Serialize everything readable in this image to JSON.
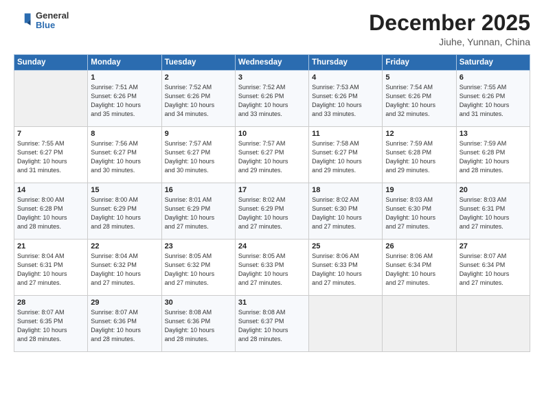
{
  "header": {
    "logo_general": "General",
    "logo_blue": "Blue",
    "month_title": "December 2025",
    "location": "Jiuhe, Yunnan, China"
  },
  "weekdays": [
    "Sunday",
    "Monday",
    "Tuesday",
    "Wednesday",
    "Thursday",
    "Friday",
    "Saturday"
  ],
  "weeks": [
    [
      {
        "day": "",
        "text": ""
      },
      {
        "day": "1",
        "text": "Sunrise: 7:51 AM\nSunset: 6:26 PM\nDaylight: 10 hours\nand 35 minutes."
      },
      {
        "day": "2",
        "text": "Sunrise: 7:52 AM\nSunset: 6:26 PM\nDaylight: 10 hours\nand 34 minutes."
      },
      {
        "day": "3",
        "text": "Sunrise: 7:52 AM\nSunset: 6:26 PM\nDaylight: 10 hours\nand 33 minutes."
      },
      {
        "day": "4",
        "text": "Sunrise: 7:53 AM\nSunset: 6:26 PM\nDaylight: 10 hours\nand 33 minutes."
      },
      {
        "day": "5",
        "text": "Sunrise: 7:54 AM\nSunset: 6:26 PM\nDaylight: 10 hours\nand 32 minutes."
      },
      {
        "day": "6",
        "text": "Sunrise: 7:55 AM\nSunset: 6:26 PM\nDaylight: 10 hours\nand 31 minutes."
      }
    ],
    [
      {
        "day": "7",
        "text": "Sunrise: 7:55 AM\nSunset: 6:27 PM\nDaylight: 10 hours\nand 31 minutes."
      },
      {
        "day": "8",
        "text": "Sunrise: 7:56 AM\nSunset: 6:27 PM\nDaylight: 10 hours\nand 30 minutes."
      },
      {
        "day": "9",
        "text": "Sunrise: 7:57 AM\nSunset: 6:27 PM\nDaylight: 10 hours\nand 30 minutes."
      },
      {
        "day": "10",
        "text": "Sunrise: 7:57 AM\nSunset: 6:27 PM\nDaylight: 10 hours\nand 29 minutes."
      },
      {
        "day": "11",
        "text": "Sunrise: 7:58 AM\nSunset: 6:27 PM\nDaylight: 10 hours\nand 29 minutes."
      },
      {
        "day": "12",
        "text": "Sunrise: 7:59 AM\nSunset: 6:28 PM\nDaylight: 10 hours\nand 29 minutes."
      },
      {
        "day": "13",
        "text": "Sunrise: 7:59 AM\nSunset: 6:28 PM\nDaylight: 10 hours\nand 28 minutes."
      }
    ],
    [
      {
        "day": "14",
        "text": "Sunrise: 8:00 AM\nSunset: 6:28 PM\nDaylight: 10 hours\nand 28 minutes."
      },
      {
        "day": "15",
        "text": "Sunrise: 8:00 AM\nSunset: 6:29 PM\nDaylight: 10 hours\nand 28 minutes."
      },
      {
        "day": "16",
        "text": "Sunrise: 8:01 AM\nSunset: 6:29 PM\nDaylight: 10 hours\nand 27 minutes."
      },
      {
        "day": "17",
        "text": "Sunrise: 8:02 AM\nSunset: 6:29 PM\nDaylight: 10 hours\nand 27 minutes."
      },
      {
        "day": "18",
        "text": "Sunrise: 8:02 AM\nSunset: 6:30 PM\nDaylight: 10 hours\nand 27 minutes."
      },
      {
        "day": "19",
        "text": "Sunrise: 8:03 AM\nSunset: 6:30 PM\nDaylight: 10 hours\nand 27 minutes."
      },
      {
        "day": "20",
        "text": "Sunrise: 8:03 AM\nSunset: 6:31 PM\nDaylight: 10 hours\nand 27 minutes."
      }
    ],
    [
      {
        "day": "21",
        "text": "Sunrise: 8:04 AM\nSunset: 6:31 PM\nDaylight: 10 hours\nand 27 minutes."
      },
      {
        "day": "22",
        "text": "Sunrise: 8:04 AM\nSunset: 6:32 PM\nDaylight: 10 hours\nand 27 minutes."
      },
      {
        "day": "23",
        "text": "Sunrise: 8:05 AM\nSunset: 6:32 PM\nDaylight: 10 hours\nand 27 minutes."
      },
      {
        "day": "24",
        "text": "Sunrise: 8:05 AM\nSunset: 6:33 PM\nDaylight: 10 hours\nand 27 minutes."
      },
      {
        "day": "25",
        "text": "Sunrise: 8:06 AM\nSunset: 6:33 PM\nDaylight: 10 hours\nand 27 minutes."
      },
      {
        "day": "26",
        "text": "Sunrise: 8:06 AM\nSunset: 6:34 PM\nDaylight: 10 hours\nand 27 minutes."
      },
      {
        "day": "27",
        "text": "Sunrise: 8:07 AM\nSunset: 6:34 PM\nDaylight: 10 hours\nand 27 minutes."
      }
    ],
    [
      {
        "day": "28",
        "text": "Sunrise: 8:07 AM\nSunset: 6:35 PM\nDaylight: 10 hours\nand 28 minutes."
      },
      {
        "day": "29",
        "text": "Sunrise: 8:07 AM\nSunset: 6:36 PM\nDaylight: 10 hours\nand 28 minutes."
      },
      {
        "day": "30",
        "text": "Sunrise: 8:08 AM\nSunset: 6:36 PM\nDaylight: 10 hours\nand 28 minutes."
      },
      {
        "day": "31",
        "text": "Sunrise: 8:08 AM\nSunset: 6:37 PM\nDaylight: 10 hours\nand 28 minutes."
      },
      {
        "day": "",
        "text": ""
      },
      {
        "day": "",
        "text": ""
      },
      {
        "day": "",
        "text": ""
      }
    ]
  ]
}
